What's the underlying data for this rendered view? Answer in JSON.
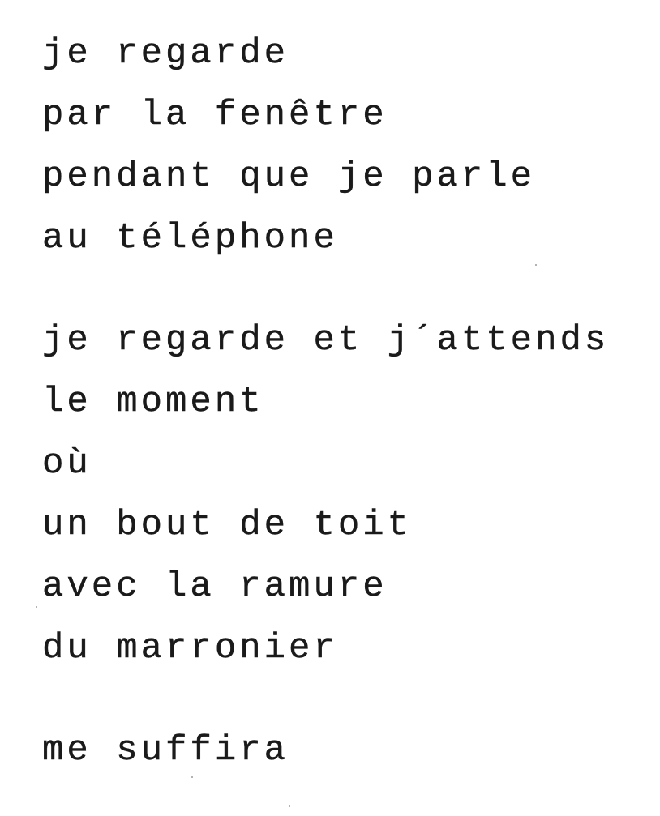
{
  "stanzas": [
    {
      "lines": [
        "je regarde",
        "par la fenêtre",
        "pendant que je parle",
        "au téléphone"
      ]
    },
    {
      "lines": [
        "je regarde et j´attends",
        "le moment",
        "où",
        "un bout de toit",
        "avec la ramure",
        "du marronier"
      ]
    },
    {
      "lines": [
        "me suffira"
      ]
    }
  ]
}
